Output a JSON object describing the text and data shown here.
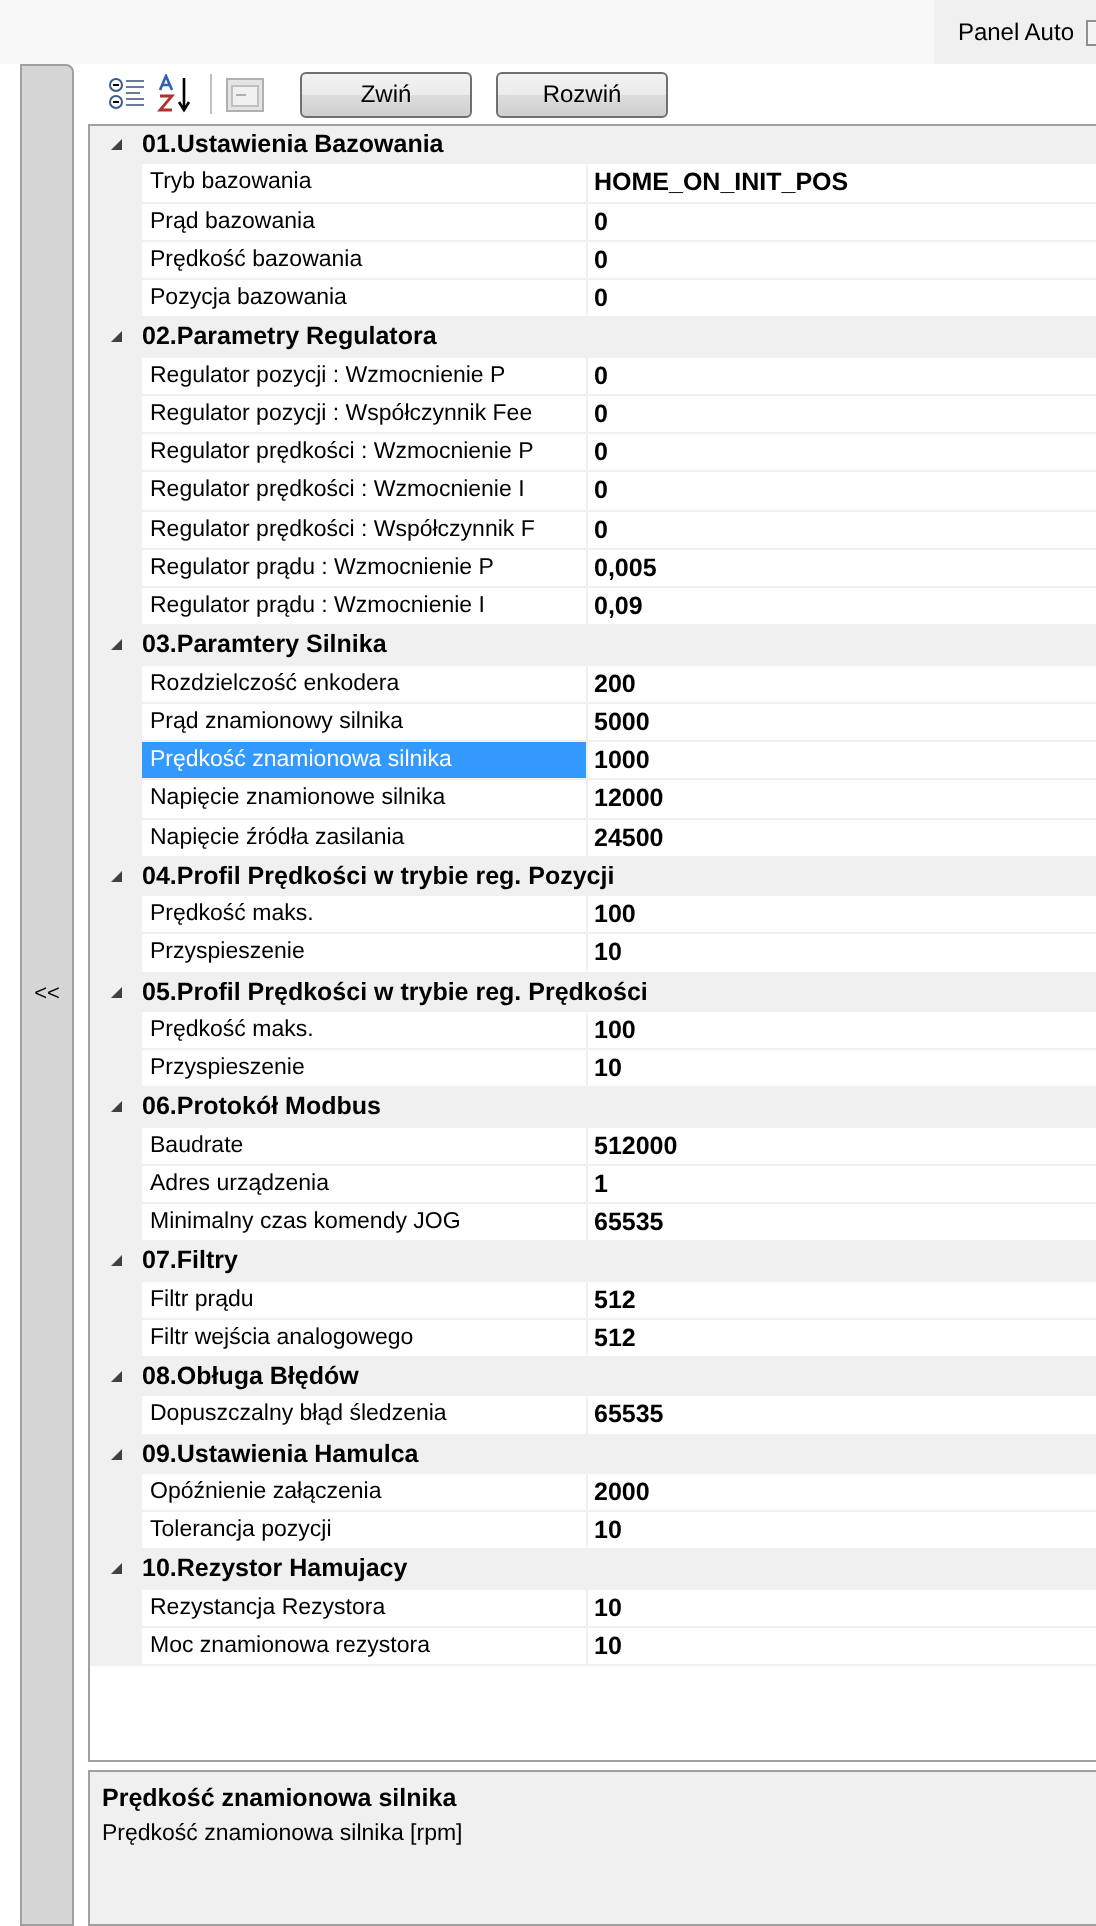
{
  "top_bar": {
    "panel_auto": {
      "label": "Panel Auto",
      "checked": false
    }
  },
  "side_panel": {
    "toggle": "<<"
  },
  "toolbar": {
    "buttons": [
      "Zwiń",
      "Rozwiń"
    ]
  },
  "categories": [
    {
      "title": "01.Ustawienia Bazowania",
      "expanded": true,
      "properties": [
        {
          "name": "Tryb bazowania",
          "value": "HOME_ON_INIT_POS",
          "selected": false
        },
        {
          "name": "Prąd bazowania",
          "value": "0",
          "selected": false
        },
        {
          "name": "Prędkość bazowania",
          "value": "0",
          "selected": false
        },
        {
          "name": "Pozycja bazowania",
          "value": "0",
          "selected": false
        }
      ]
    },
    {
      "title": "02.Parametry Regulatora",
      "expanded": true,
      "properties": [
        {
          "name": "Regulator pozycji : Wzmocnienie P",
          "value": "0",
          "selected": false
        },
        {
          "name": "Regulator pozycji : Współczynnik Fee",
          "value": "0",
          "selected": false
        },
        {
          "name": "Regulator prędkości : Wzmocnienie P",
          "value": "0",
          "selected": false
        },
        {
          "name": "Regulator prędkości : Wzmocnienie I",
          "value": "0",
          "selected": false
        },
        {
          "name": "Regulator prędkości : Współczynnik F",
          "value": "0",
          "selected": false
        },
        {
          "name": "Regulator prądu : Wzmocnienie P",
          "value": "0,005",
          "selected": false
        },
        {
          "name": "Regulator prądu : Wzmocnienie I",
          "value": "0,09",
          "selected": false
        }
      ]
    },
    {
      "title": "03.Paramtery Silnika",
      "expanded": true,
      "properties": [
        {
          "name": "Rozdzielczość enkodera",
          "value": "200",
          "selected": false
        },
        {
          "name": "Prąd znamionowy silnika",
          "value": "5000",
          "selected": false
        },
        {
          "name": "Prędkość znamionowa silnika",
          "value": "1000",
          "selected": true
        },
        {
          "name": "Napięcie znamionowe silnika",
          "value": "12000",
          "selected": false
        },
        {
          "name": "Napięcie źródła zasilania",
          "value": "24500",
          "selected": false
        }
      ]
    },
    {
      "title": "04.Profil Prędkości w trybie reg. Pozycji",
      "expanded": true,
      "properties": [
        {
          "name": "Prędkość maks.",
          "value": "100",
          "selected": false
        },
        {
          "name": "Przyspieszenie",
          "value": "10",
          "selected": false
        }
      ]
    },
    {
      "title": "05.Profil Prędkości w trybie reg. Prędkości",
      "expanded": true,
      "properties": [
        {
          "name": "Prędkość maks.",
          "value": "100",
          "selected": false
        },
        {
          "name": "Przyspieszenie",
          "value": "10",
          "selected": false
        }
      ]
    },
    {
      "title": "06.Protokół Modbus",
      "expanded": true,
      "properties": [
        {
          "name": "Baudrate",
          "value": "512000",
          "selected": false
        },
        {
          "name": "Adres urządzenia",
          "value": "1",
          "selected": false
        },
        {
          "name": "Minimalny czas komendy JOG",
          "value": "65535",
          "selected": false
        }
      ]
    },
    {
      "title": "07.Filtry",
      "expanded": true,
      "properties": [
        {
          "name": "Filtr prądu",
          "value": "512",
          "selected": false
        },
        {
          "name": "Filtr wejścia analogowego",
          "value": "512",
          "selected": false
        }
      ]
    },
    {
      "title": "08.Obługa Błędów",
      "expanded": true,
      "properties": [
        {
          "name": "Dopuszczalny błąd śledzenia",
          "value": "65535",
          "selected": false
        }
      ]
    },
    {
      "title": "09.Ustawienia Hamulca",
      "expanded": true,
      "properties": [
        {
          "name": "Opóźnienie załączenia",
          "value": "2000",
          "selected": false
        },
        {
          "name": "Tolerancja pozycji",
          "value": "10",
          "selected": false
        }
      ]
    },
    {
      "title": "10.Rezystor Hamujacy",
      "expanded": true,
      "properties": [
        {
          "name": "Rezystancja Rezystora",
          "value": "10",
          "selected": false
        },
        {
          "name": "Moc znamionowa rezystora",
          "value": "10",
          "selected": false
        }
      ]
    }
  ],
  "description": {
    "title": "Prędkość znamionowa silnika",
    "text": "Prędkość znamionowa silnika [rpm]"
  }
}
